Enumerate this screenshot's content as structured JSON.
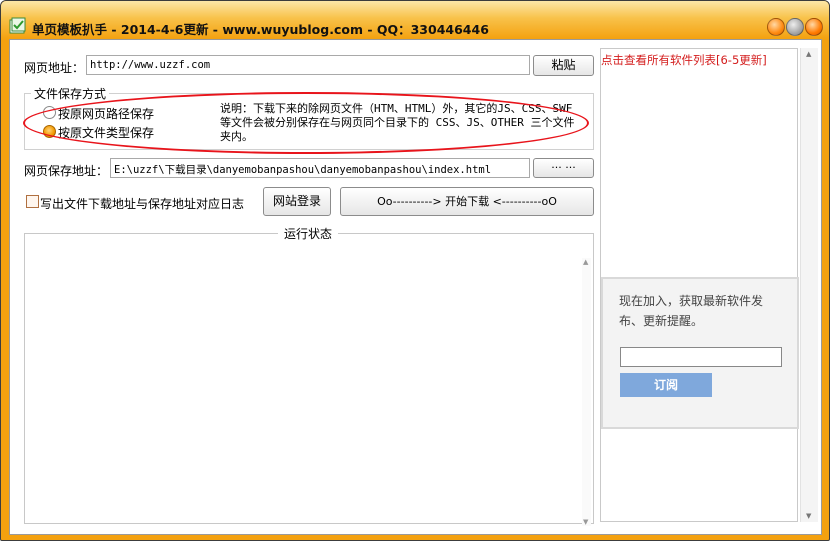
{
  "window": {
    "title": "单页模板扒手 - 2014-4-6更新 - www.wuyublog.com - QQ：330446446"
  },
  "url_row": {
    "label": "网页地址：",
    "value": "http://www.uzzf.com",
    "paste_button": "粘贴"
  },
  "save_mode": {
    "legend": "文件保存方式",
    "option_path": "按原网页路径保存",
    "option_type": "按原文件类型保存",
    "selected": "option_type",
    "description": "说明：下载下来的除网页文件（HTM、HTML）外，其它的JS、CSS、SWF等文件会被分别保存在与网页同个目录下的 CSS、JS、OTHER 三个文件夹内。"
  },
  "save_path_row": {
    "label": "网页保存地址：",
    "value": "E:\\uzzf\\下载目录\\danyemobanpashou\\danyemobanpashou\\index.html",
    "browse_button": "··· ···"
  },
  "actions": {
    "log_checkbox_label": "写出文件下载地址与保存地址对应日志",
    "log_checked": false,
    "login_button": "网站登录",
    "download_button": "Oo----------> 开始下载 <----------oO"
  },
  "status": {
    "legend": "运行状态"
  },
  "right_panel": {
    "link": "点击查看所有软件列表[6-5更新]",
    "subscribe_text": "现在加入，获取最新软件发布、更新提醒。",
    "subscribe_button": "订阅"
  },
  "colors": {
    "title_gradient_top": "#fde7a8",
    "title_gradient_bottom": "#f4a10f",
    "highlight_ellipse": "#e8141b",
    "link": "#d41e1e",
    "subscribe_button": "#7fa8dc"
  }
}
